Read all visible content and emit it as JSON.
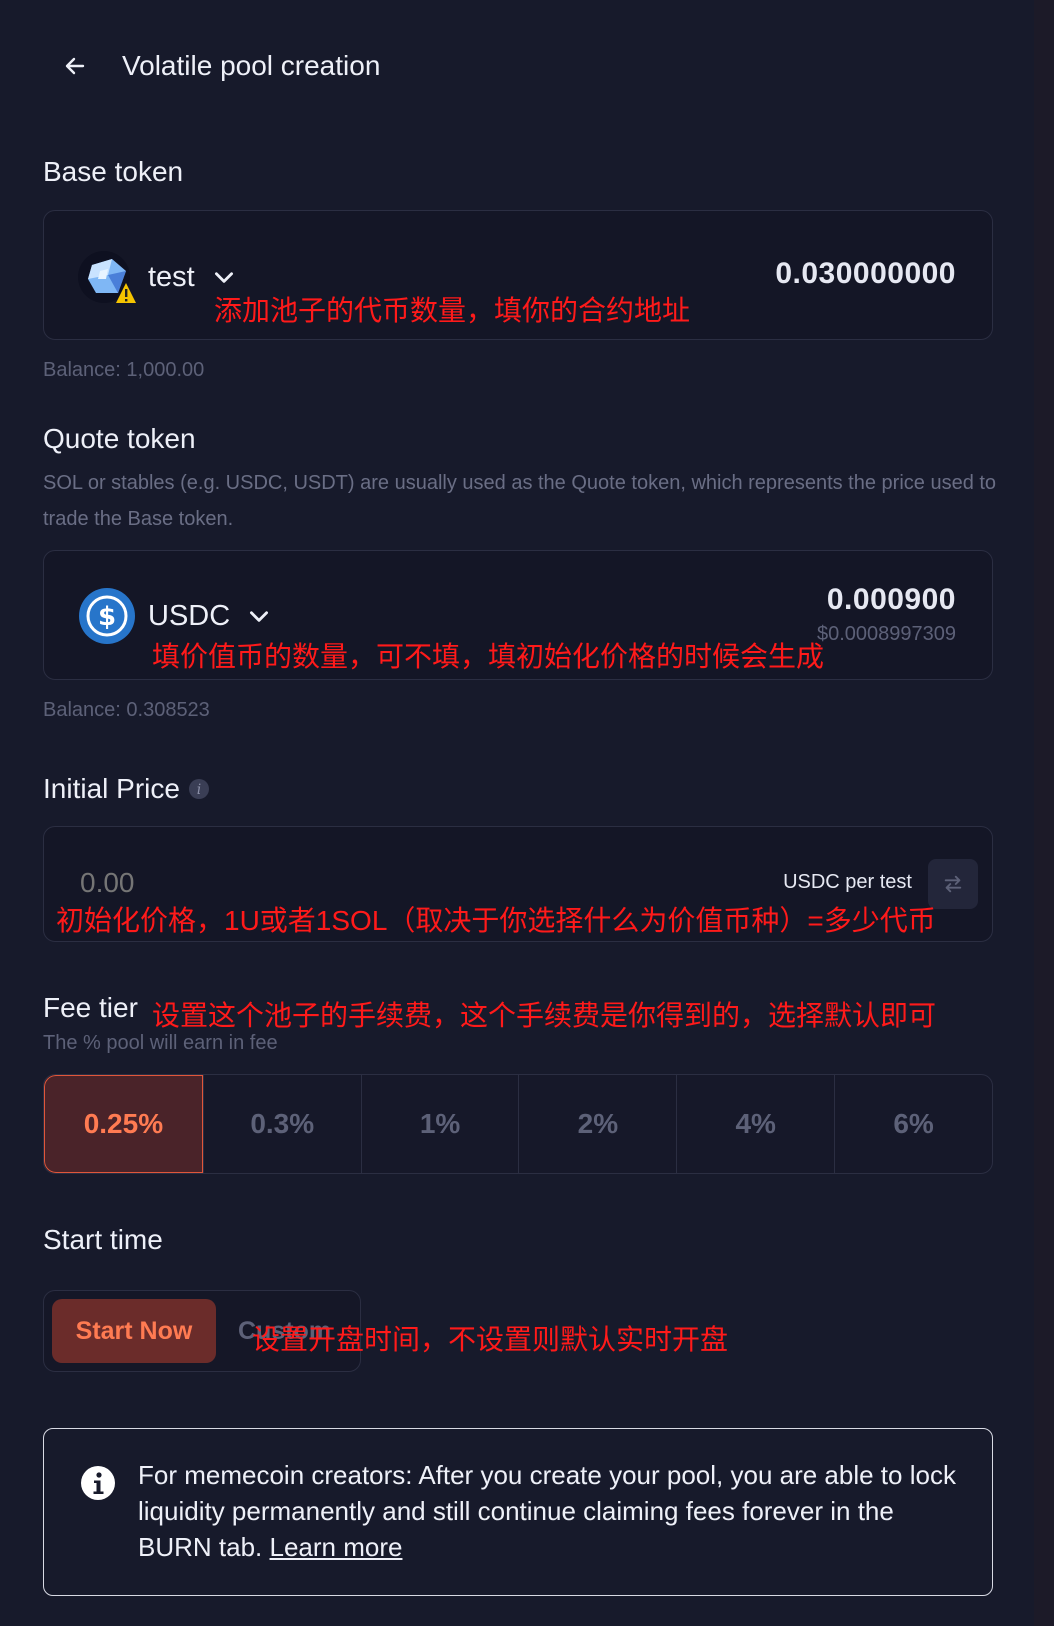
{
  "header": {
    "title": "Volatile pool creation"
  },
  "base": {
    "title": "Base token",
    "token_name": "test",
    "amount": "0.030000000",
    "annotation": "添加池子的代币数量，填你的合约地址",
    "balance": "Balance: 1,000.00"
  },
  "quote": {
    "title": "Quote token",
    "description": "SOL or stables (e.g. USDC, USDT) are usually used as the Quote token, which represents the price used to trade the Base token.",
    "token_name": "USDC",
    "amount": "0.000900",
    "usd_value": "$0.0008997309",
    "annotation": "填价值币的数量，可不填，填初始化价格的时候会生成",
    "balance": "Balance: 0.308523"
  },
  "price": {
    "title": "Initial Price",
    "placeholder": "0.00",
    "unit": "USDC per test",
    "annotation": "初始化价格，1U或者1SOL（取决于你选择什么为价值币种）=多少代币"
  },
  "fee": {
    "title": "Fee tier",
    "subtitle": "The % pool will earn in fee",
    "annotation": "设置这个池子的手续费，这个手续费是你得到的，选择默认即可",
    "options": [
      "0.25%",
      "0.3%",
      "1%",
      "2%",
      "4%",
      "6%"
    ],
    "selected": "0.25%"
  },
  "start": {
    "title": "Start time",
    "now_label": "Start Now",
    "custom_label": "Custom",
    "annotation": "设置开盘时间，不设置则默认实时开盘"
  },
  "info": {
    "text": "For memecoin creators: After you create your pool, you are able to lock liquidity permanently and still continue claiming fees forever in the BURN tab. ",
    "link": "Learn more"
  },
  "colors": {
    "background": "#171a2b",
    "accent": "#ff7b52",
    "annotation": "#ff1a1a",
    "usdc": "#2775ca"
  }
}
